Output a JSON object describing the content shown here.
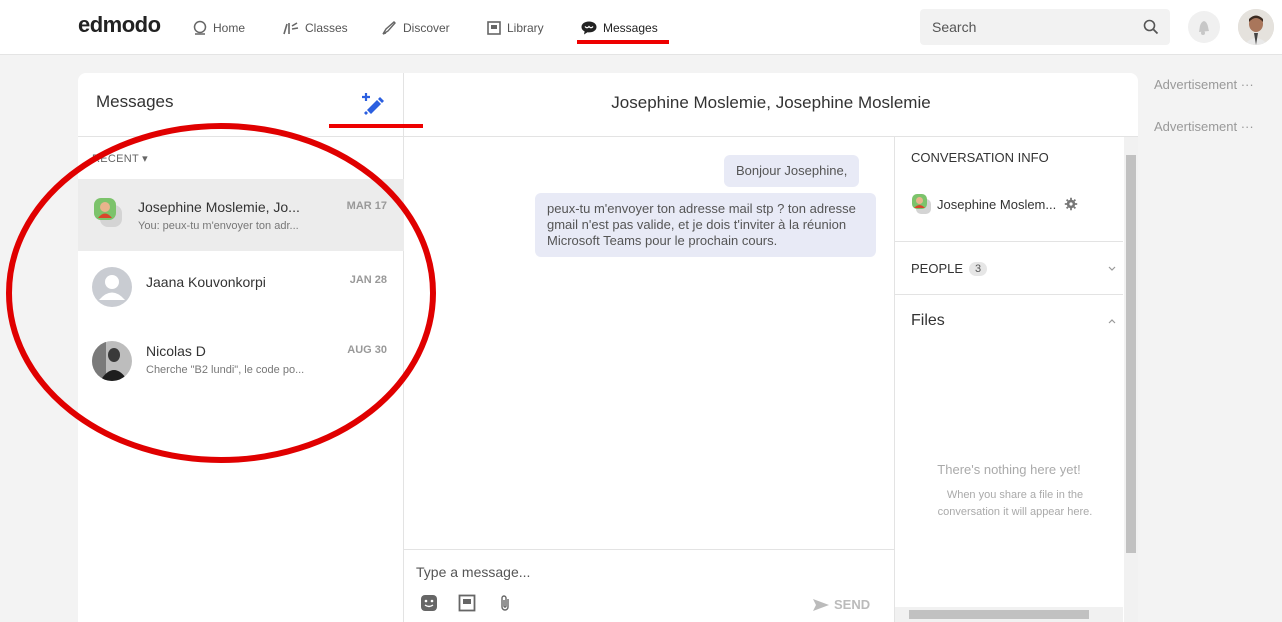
{
  "topbar": {
    "logo": "edmodo",
    "nav": [
      {
        "label": "Home",
        "icon": "home-icon"
      },
      {
        "label": "Classes",
        "icon": "classes-icon"
      },
      {
        "label": "Discover",
        "icon": "discover-icon"
      },
      {
        "label": "Library",
        "icon": "library-icon"
      },
      {
        "label": "Messages",
        "icon": "messages-icon",
        "active": true
      }
    ],
    "search_placeholder": "Search"
  },
  "messages_panel": {
    "title": "Messages",
    "recent_label": "RECENT",
    "conversations": [
      {
        "name": "Josephine Moslemie, Jo...",
        "snippet": "You: peux-tu m'envoyer ton adr...",
        "date": "MAR 17",
        "active": true
      },
      {
        "name": "Jaana Kouvonkorpi",
        "snippet": "",
        "date": "JAN 28"
      },
      {
        "name": "Nicolas D",
        "snippet": "Cherche \"B2 lundi\", le code po...",
        "date": "AUG 30"
      }
    ]
  },
  "conversation": {
    "title": "Josephine Moslemie, Josephine Moslemie",
    "messages": [
      {
        "text": "Bonjour Josephine,"
      },
      {
        "text": "peux-tu m'envoyer ton adresse mail stp ? ton adresse gmail n'est pas valide, et je dois t'inviter à la réunion Microsoft Teams pour le prochain cours."
      }
    ],
    "composer_placeholder": "Type a message...",
    "send_label": "SEND"
  },
  "info": {
    "title": "CONVERSATION INFO",
    "member": "Josephine Moslem...",
    "people_label": "PEOPLE",
    "people_count": "3",
    "files_label": "Files",
    "empty_title": "There's nothing here yet!",
    "empty_body": "When you share a file in the conversation it will appear here."
  },
  "ads": {
    "label1": "Advertisement",
    "label2": "Advertisement",
    "more": "···"
  },
  "colors": {
    "annotation_red": "#e00000",
    "compose_blue": "#2b5fe0",
    "bubble_bg": "#e8eaf6",
    "active_row": "#ececec"
  }
}
